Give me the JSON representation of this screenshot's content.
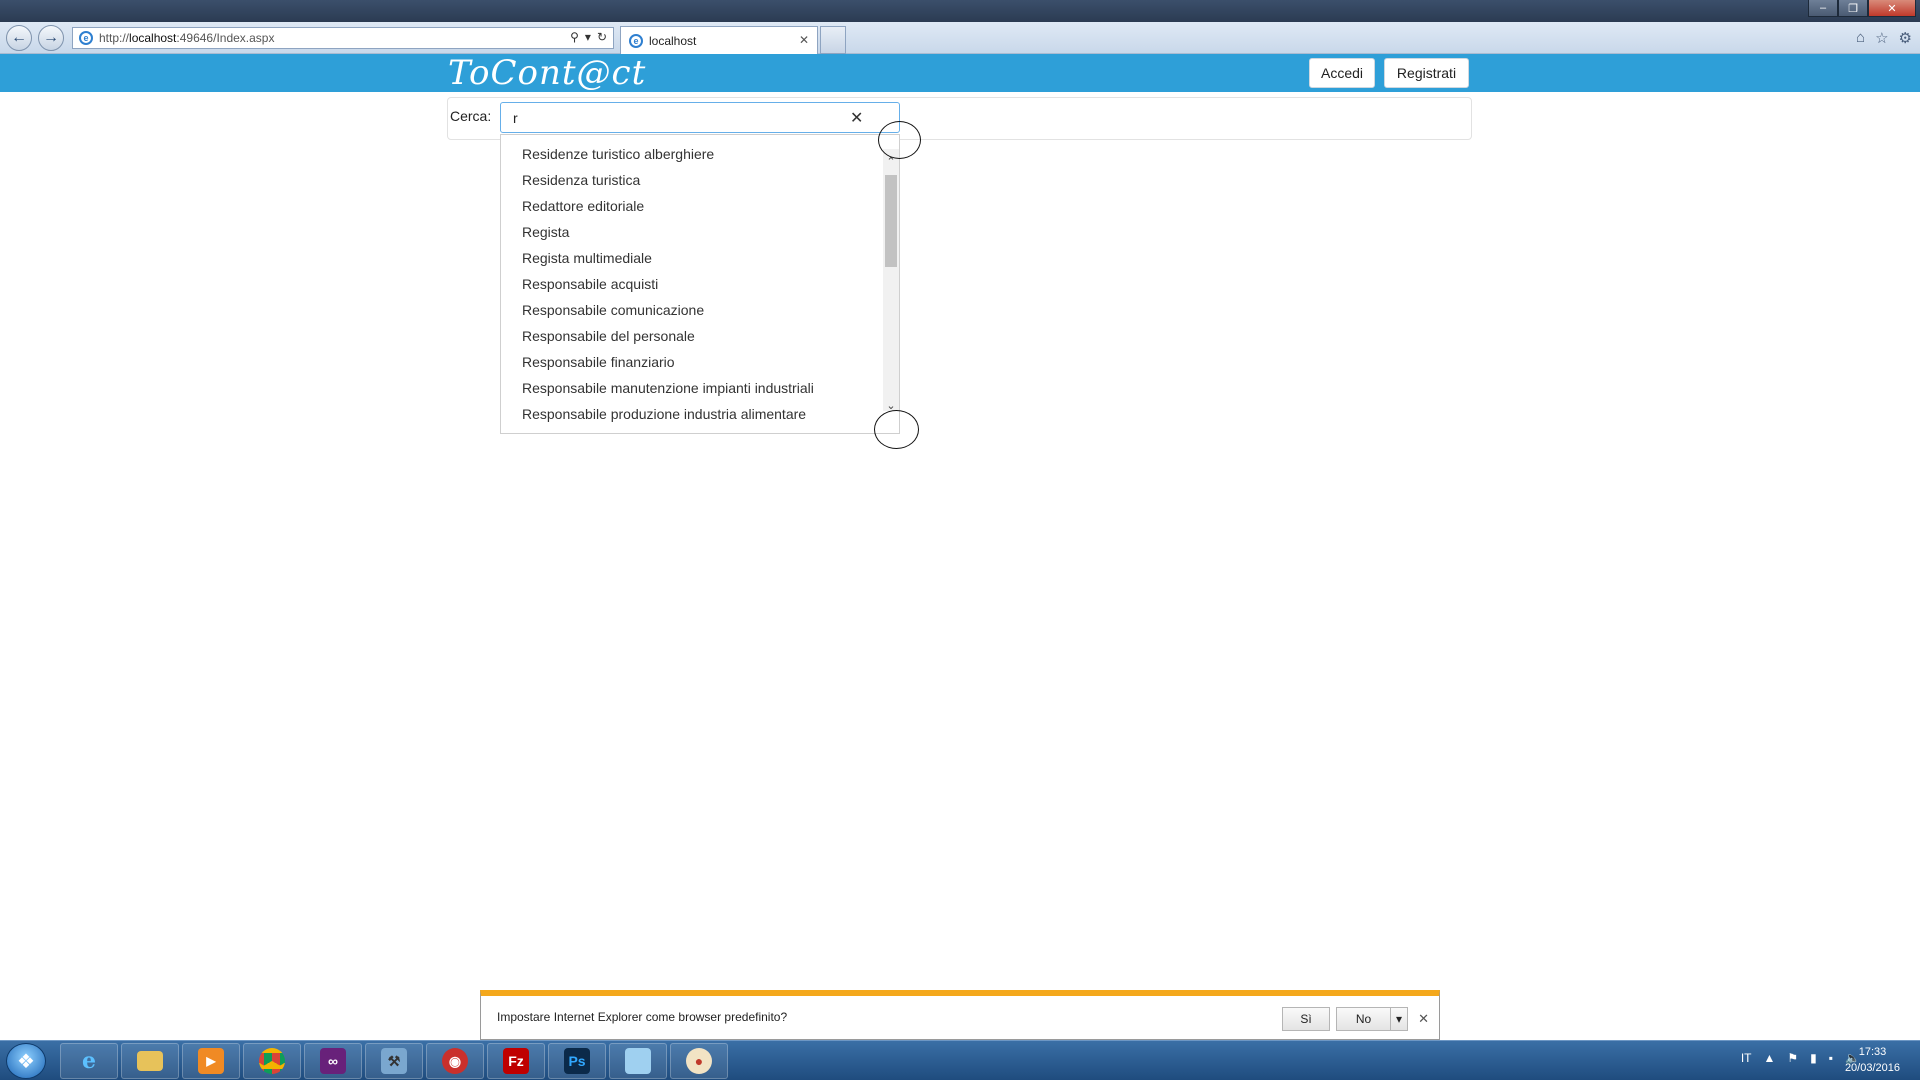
{
  "browser": {
    "url_prefix": "http://",
    "url_host": "localhost",
    "url_rest": ":49646/Index.aspx",
    "tab_title": "localhost",
    "colors": {
      "site_header": "#2e9fd8",
      "notify_accent": "#f4a81c"
    }
  },
  "header": {
    "logo": "ToCont@ct",
    "login_label": "Accedi",
    "register_label": "Registrati"
  },
  "search": {
    "label": "Cerca:",
    "value": "r",
    "suggestions": [
      "Residenze turistico alberghiere",
      "Residenza turistica",
      "Redattore editoriale",
      "Regista",
      "Regista multimediale",
      "Responsabile acquisti",
      "Responsabile comunicazione",
      "Responsabile del personale",
      "Responsabile finanziario",
      "Responsabile manutenzione impianti industriali",
      "Responsabile produzione industria alimentare"
    ]
  },
  "notification": {
    "text": "Impostare Internet Explorer come browser predefinito?",
    "yes_label": "Sì",
    "no_label": "No"
  },
  "taskbar": {
    "language": "IT",
    "time": "17:33",
    "date": "20/03/2016",
    "apps": [
      "ie-icon",
      "explorer-icon",
      "media-player-icon",
      "chrome-icon",
      "visual-studio-icon",
      "tools-icon",
      "antivirus-icon",
      "filezilla-icon",
      "photoshop-icon",
      "notepad-icon",
      "paint-icon"
    ],
    "filezilla_glyph": "Fz",
    "photoshop_glyph": "Ps"
  }
}
